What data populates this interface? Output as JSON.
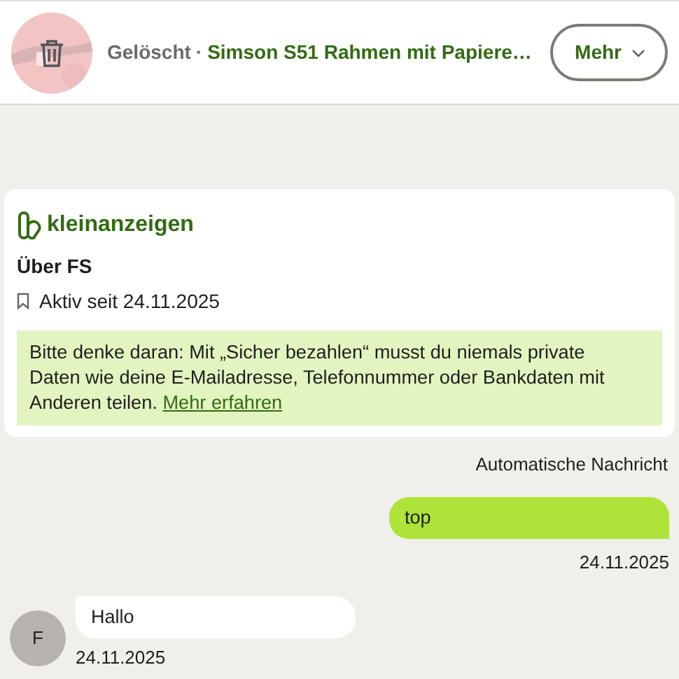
{
  "header": {
    "status": "Gelöscht",
    "separator": "·",
    "title": "Simson S51 Rahmen mit Papiere…",
    "more_button": "Mehr"
  },
  "info_card": {
    "brand": "kleinanzeigen",
    "heading": "Über FS",
    "active_since": "Aktiv seit 24.11.2025",
    "notice": "Bitte denke daran: Mit „Sicher bezahlen“ musst du niemals private Daten wie deine E-Mailadresse, Telefonnummer oder Bankdaten mit Anderen teilen.",
    "notice_link": "Mehr erfahren",
    "caption": "Automatische Nachricht"
  },
  "messages": [
    {
      "kind": "outgoing",
      "text": "top",
      "date": "24.11.2025"
    },
    {
      "kind": "incoming",
      "avatar": "F",
      "text": "Hallo",
      "date": "24.11.2025"
    }
  ]
}
